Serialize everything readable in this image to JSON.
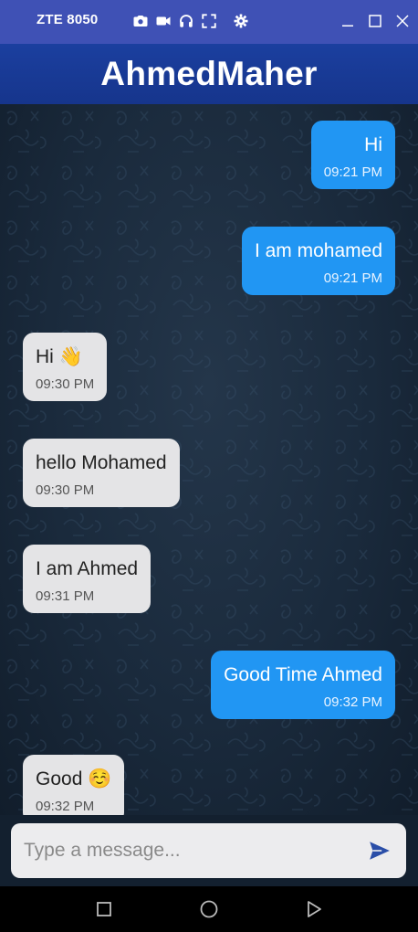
{
  "emulator": {
    "title": "ZTE 8050",
    "toolbar_icons": [
      "camera-icon",
      "video-icon",
      "headphones-icon",
      "fullscreen-icon",
      "gear-icon"
    ],
    "window_icons": [
      "minimize-icon",
      "maximize-icon",
      "close-icon"
    ]
  },
  "header": {
    "title": "AhmedMaher"
  },
  "messages": [
    {
      "direction": "sent",
      "text": "Hi",
      "time": "09:21 PM"
    },
    {
      "direction": "sent",
      "text": "I am mohamed",
      "time": "09:21 PM"
    },
    {
      "direction": "received",
      "text": "Hi 👋",
      "time": "09:30 PM"
    },
    {
      "direction": "received",
      "text": "hello Mohamed",
      "time": "09:30 PM"
    },
    {
      "direction": "received",
      "text": "I am Ahmed",
      "time": "09:31 PM"
    },
    {
      "direction": "sent",
      "text": "Good Time Ahmed",
      "time": "09:32 PM"
    },
    {
      "direction": "received",
      "text": "Good ☺️",
      "time": "09:32 PM"
    }
  ],
  "composer": {
    "placeholder": "Type a message...",
    "value": ""
  },
  "colors": {
    "emulator_bar": "#3f51b5",
    "header": "#1b3f9f",
    "sent_bubble": "#2196f3",
    "received_bubble": "#e4e4e6",
    "send_icon": "#2a4ea8"
  },
  "nav": [
    "recent-apps-icon",
    "home-icon",
    "back-icon"
  ]
}
